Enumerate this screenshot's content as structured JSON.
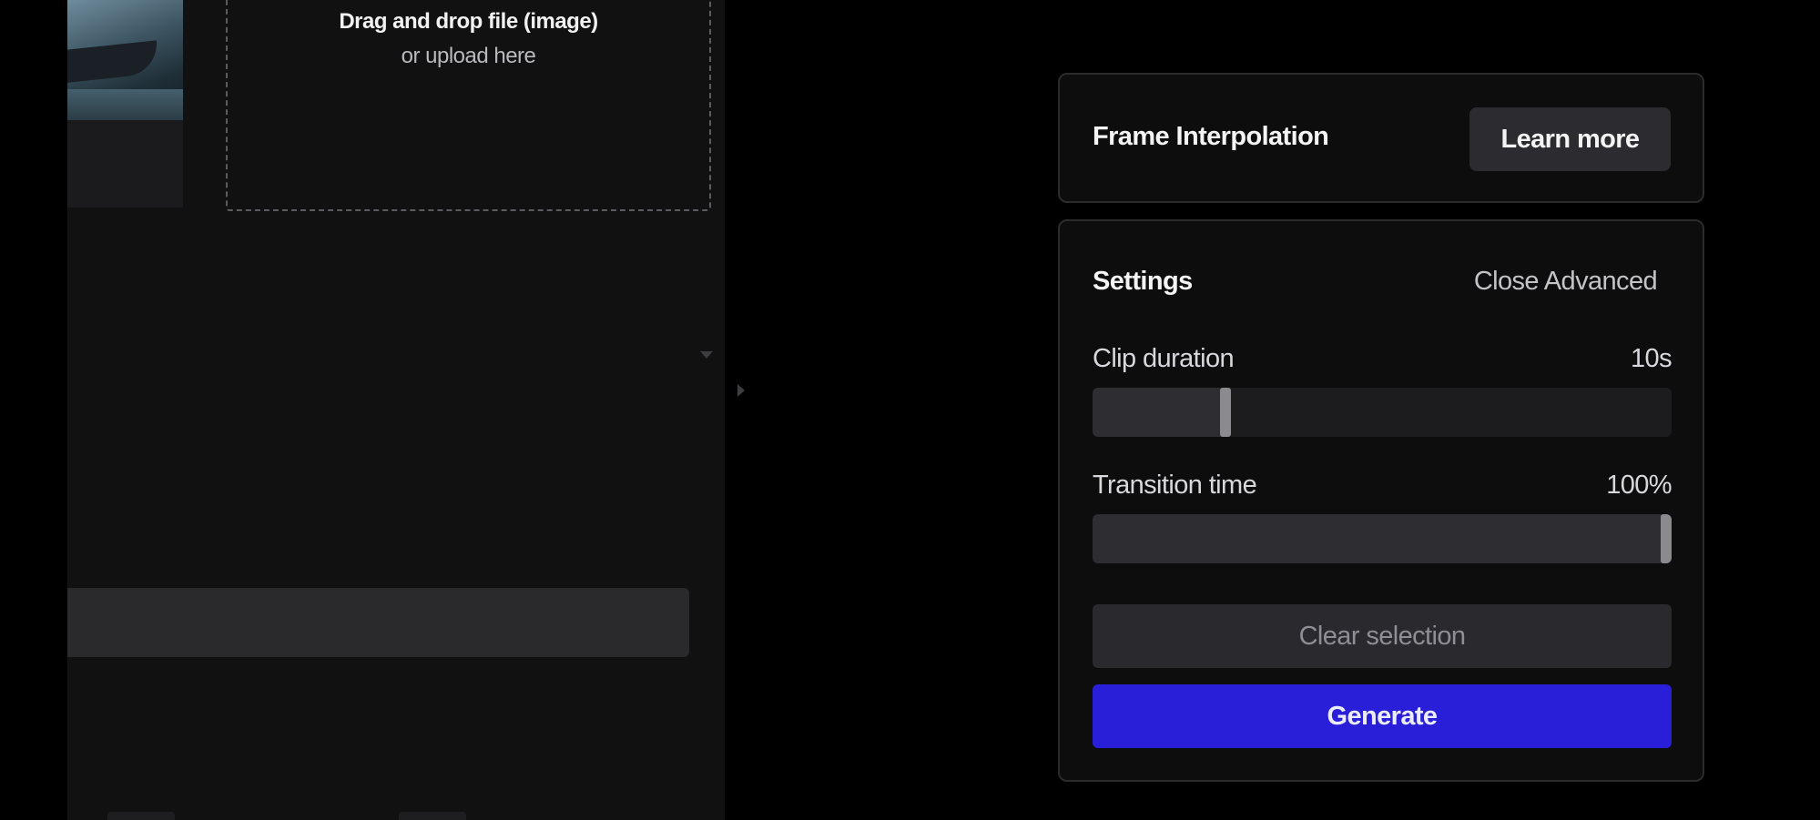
{
  "upload": {
    "line1": "Drag and drop file (image)",
    "line2": "or upload here"
  },
  "frame_interpolation": {
    "title": "Frame Interpolation",
    "learn_more_label": "Learn more"
  },
  "settings": {
    "title": "Settings",
    "close_advanced_label": "Close Advanced",
    "clip_duration": {
      "label": "Clip duration",
      "value": "10s",
      "level": 0.23
    },
    "transition_time": {
      "label": "Transition time",
      "value": "100%",
      "level": 1.0
    },
    "clear_selection_label": "Clear selection",
    "generate_label": "Generate"
  },
  "colors": {
    "accent": "#2a1fd8",
    "background": "#000000",
    "panel": "#111112",
    "card": "#0d0d0e"
  }
}
